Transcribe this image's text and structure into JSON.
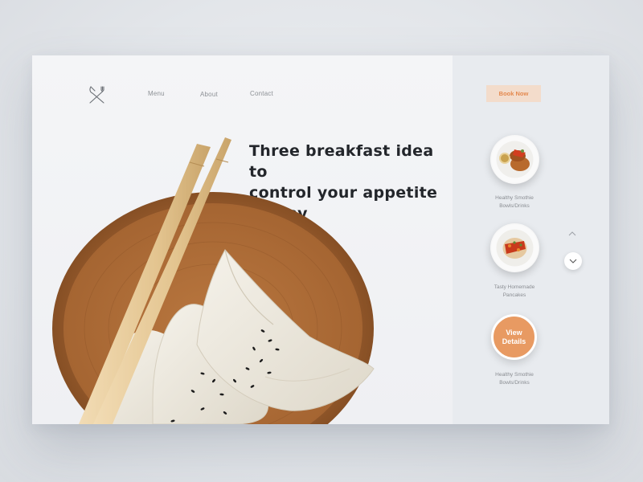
{
  "nav": {
    "links": [
      "Menu",
      "About",
      "Contact"
    ],
    "book_label": "Book Now"
  },
  "hero": {
    "headline_lines": [
      "Three breakfast idea to",
      "control your appetite",
      "all day"
    ]
  },
  "sidebar": {
    "items": [
      {
        "label_lines": [
          "Healthy Smothie",
          "Bowls/Drinks"
        ],
        "icon": "food-plate-icon"
      },
      {
        "label_lines": [
          "Tasty Homemade",
          "Pancakes"
        ],
        "icon": "food-plate-icon"
      },
      {
        "label_lines": [
          "Healthy Smothie",
          "Bowls/Drinks"
        ],
        "icon": "view-details-button"
      }
    ],
    "view_details_lines": [
      "View",
      "Details"
    ]
  },
  "colors": {
    "accent": "#e89a62",
    "book_bg": "#f3dccb",
    "book_text": "#e4894f",
    "headline": "#23262b"
  },
  "icons": {
    "logo": "fork-knife-icon",
    "scroll_up": "chevron-up-icon",
    "scroll_down": "chevron-down-icon"
  }
}
